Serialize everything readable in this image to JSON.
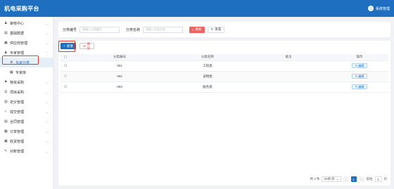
{
  "header": {
    "title": "机电采购平台",
    "user": "系统管理"
  },
  "sidebar": {
    "items": [
      {
        "icon": "♟",
        "label": "审核中心",
        "chevron": "⌄"
      },
      {
        "icon": "▤",
        "label": "基础数据",
        "chevron": "⌄"
      },
      {
        "icon": "▣",
        "label": "供应商管理",
        "chevron": "⌄"
      },
      {
        "icon": "♟",
        "label": "专家管理",
        "chevron": "⌃"
      },
      {
        "icon": "⚙",
        "label": "专家分类",
        "chevron": ""
      },
      {
        "icon": "▦",
        "label": "专家库",
        "chevron": ""
      },
      {
        "icon": "⚑",
        "label": "物资采购",
        "chevron": "⌄"
      },
      {
        "icon": "☰",
        "label": "项目采购",
        "chevron": "⌄"
      },
      {
        "icon": "▥",
        "label": "定价管理",
        "chevron": "⌄"
      },
      {
        "icon": "✓",
        "label": "成交管理",
        "chevron": "⌄"
      },
      {
        "icon": "▤",
        "label": "合同管理",
        "chevron": "⌄"
      },
      {
        "icon": "▦",
        "label": "订单管理",
        "chevron": "⌄"
      },
      {
        "icon": "▣",
        "label": "收货管理",
        "chevron": "⌄"
      },
      {
        "icon": "✎",
        "label": "对账管理",
        "chevron": "⌄"
      }
    ]
  },
  "filter": {
    "code_label": "分类编号",
    "code_placeholder": "请输入分类编号",
    "name_label": "分类名称",
    "name_placeholder": "请输入分类名称",
    "search_label": "搜索",
    "reset_label": "重置"
  },
  "toolbar": {
    "add_label": "新增",
    "delete_label": "删除"
  },
  "table": {
    "headers": [
      "",
      "分类编号",
      "分类名称",
      "备注",
      "操作"
    ],
    "rows": [
      {
        "code": "001",
        "name": "工程类",
        "note": "",
        "action": "编辑"
      },
      {
        "code": "002",
        "name": "该物类",
        "note": "",
        "action": "编辑"
      },
      {
        "code": "003",
        "name": "服务类",
        "note": "",
        "action": "编辑"
      }
    ]
  },
  "pagination": {
    "total": "共 3 条",
    "page_size": "20条/页",
    "prev": "‹",
    "current": "1",
    "next": "›",
    "goto_label": "前往",
    "goto_value": "1",
    "page_unit": "页"
  },
  "colors": {
    "primary": "#1f6fc1",
    "danger": "#f06161",
    "highlight": "#e8372b"
  }
}
